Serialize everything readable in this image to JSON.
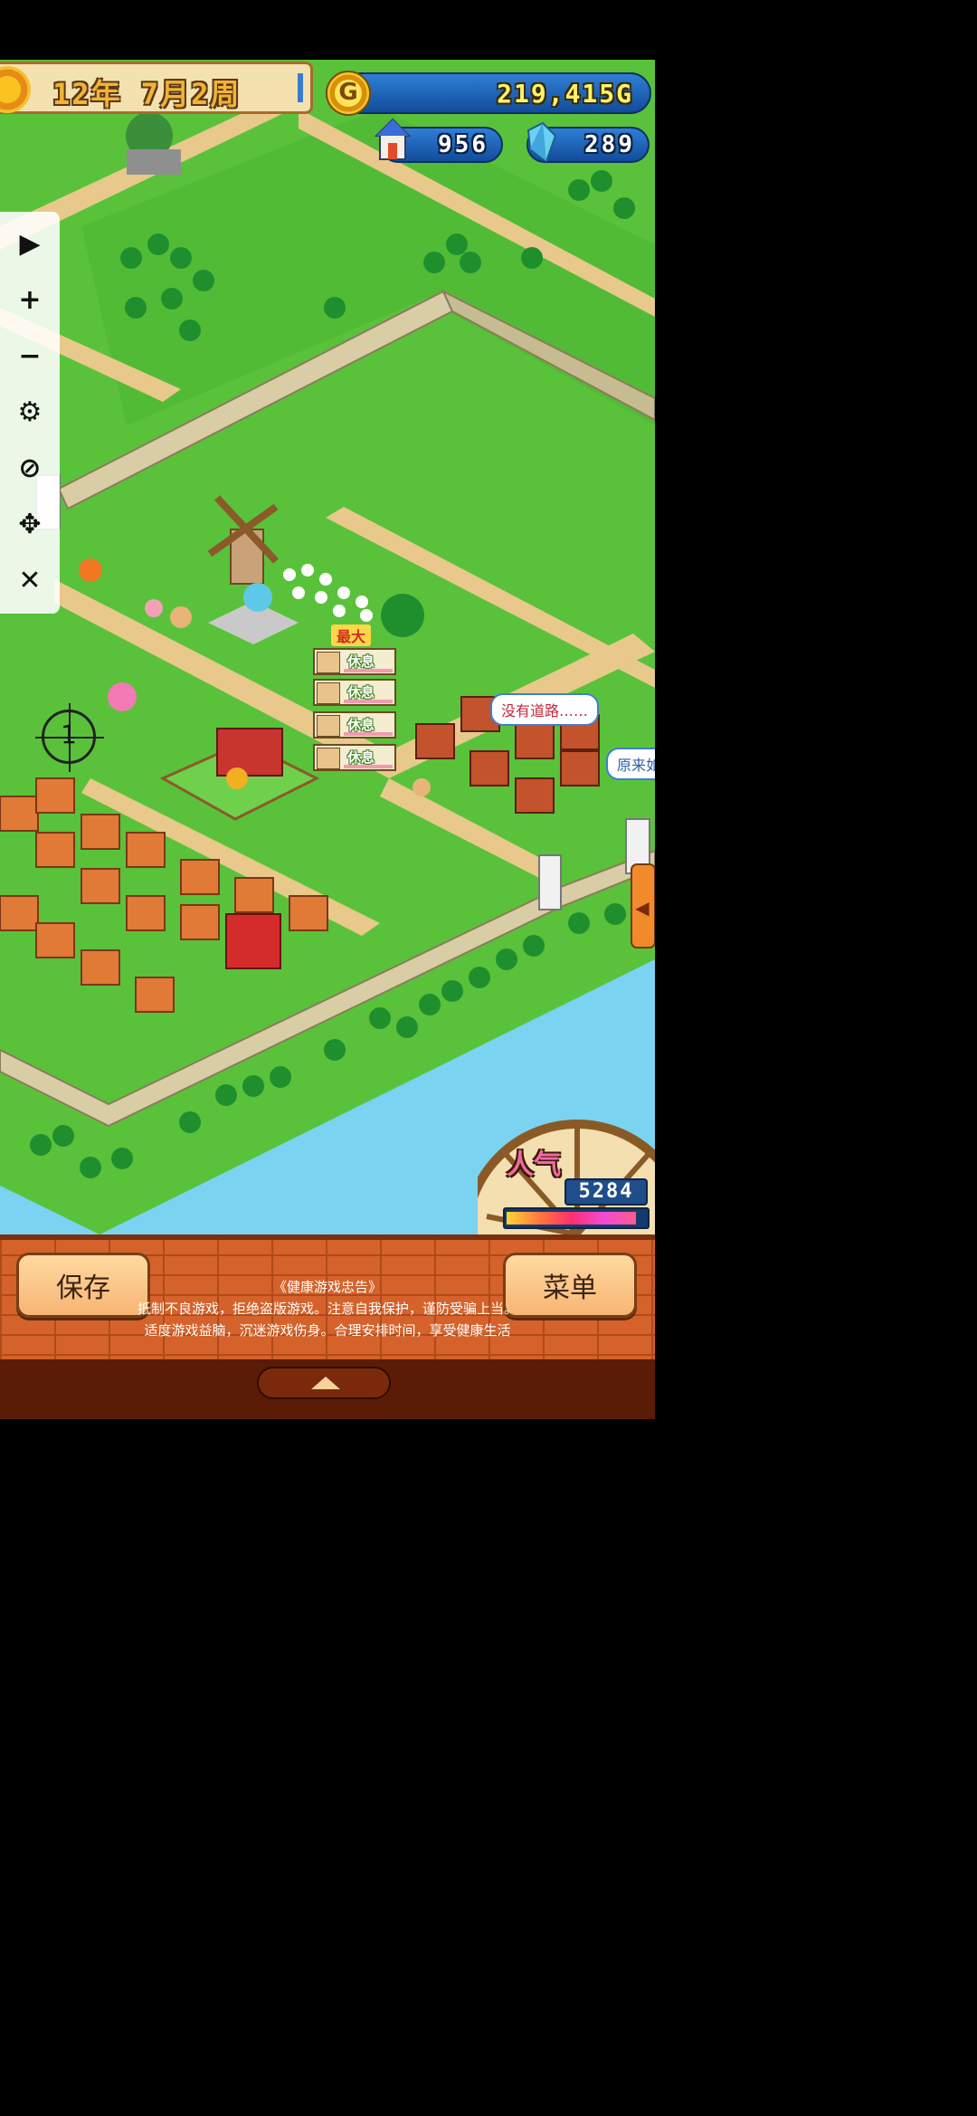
{
  "hud": {
    "date": "12年 7月2周",
    "gold": "219,415G",
    "coin_symbol": "G",
    "houses": "956",
    "crystals": "289",
    "popularity_label": "人气",
    "popularity": "5284",
    "popularity_level": 0.93
  },
  "toolbar": {
    "items": [
      "play-icon",
      "plus-icon",
      "minus-icon",
      "gear-icon",
      "eye-off-icon",
      "move-icon",
      "close-icon"
    ],
    "glyphs": [
      "▶",
      "+",
      "−",
      "⚙",
      "⊘",
      "✥",
      "✕"
    ]
  },
  "bubbles": {
    "no_road": "没有道路……",
    "original": "原来如"
  },
  "workers": {
    "max_label": "最大",
    "status": [
      "休息",
      "休息",
      "休息",
      "休息"
    ]
  },
  "map": {
    "marker_number": "1"
  },
  "bottom": {
    "save": "保存",
    "menu": "菜单",
    "notice_title": "《健康游戏忠告》",
    "notice_line1": "抵制不良游戏，拒绝盗版游戏。注意自我保护，谨防受骗上当。",
    "notice_line2": "适度游戏益脑，沉迷游戏伤身。合理安排时间，享受健康生活"
  },
  "colors": {
    "grass": "#59c23a",
    "road": "#e8c98b",
    "water": "#7bd3f2",
    "brick": "#d4622a"
  }
}
